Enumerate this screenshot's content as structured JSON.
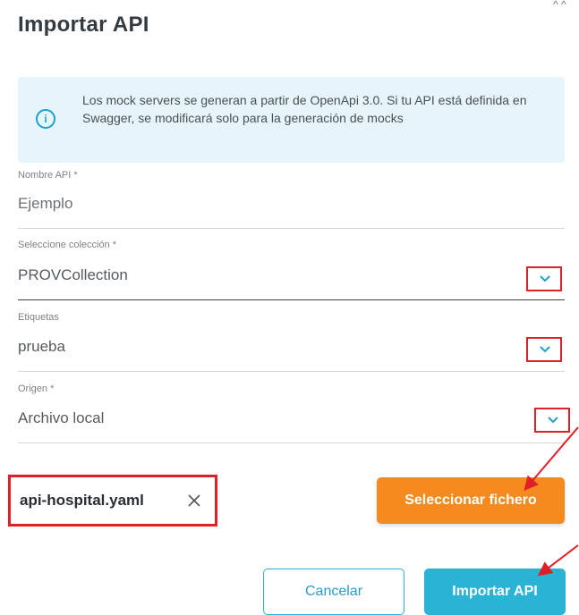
{
  "dialog": {
    "title": "Importar API",
    "close_hint": "^ ^"
  },
  "info": {
    "icon": "info-icon",
    "text": "Los mock servers se generan a partir de OpenApi 3.0. Si tu API está definida en Swagger, se modificará solo para la generación de mocks"
  },
  "fields": {
    "api_name": {
      "label": "Nombre API *",
      "value": "Ejemplo"
    },
    "collection": {
      "label": "Seleccione colección *",
      "value": "PROVCollection"
    },
    "tags": {
      "label": "Etiquetas",
      "value": "prueba"
    },
    "origin": {
      "label": "Origen *",
      "value": "Archivo local"
    }
  },
  "file": {
    "name": "api-hospital.yaml",
    "remove_icon": "close-icon"
  },
  "buttons": {
    "select_file": "Seleccionar fichero",
    "cancel": "Cancelar",
    "import": "Importar API"
  },
  "colors": {
    "accent": "#2bb3d6",
    "orange": "#f58a1f",
    "highlight": "#e01f26",
    "info_bg": "#e5f5fb"
  }
}
